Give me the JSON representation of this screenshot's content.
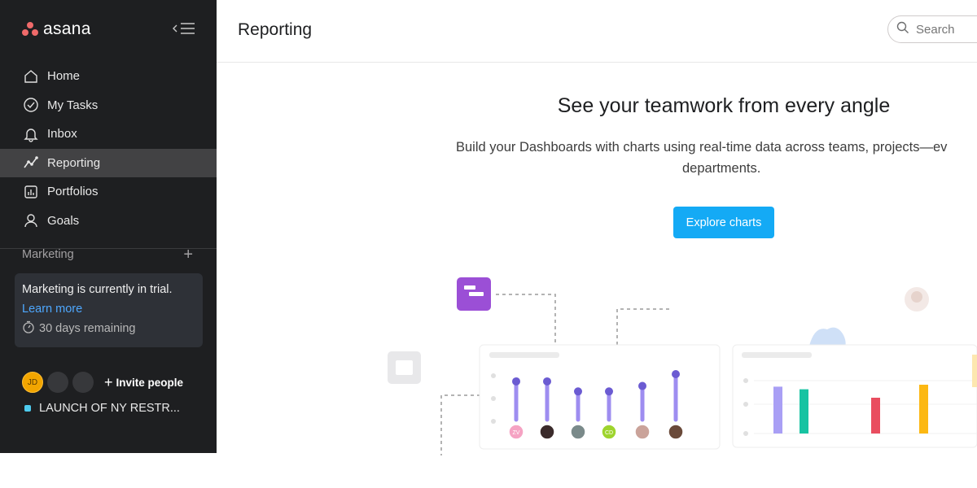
{
  "app": {
    "logo_text": "asana"
  },
  "sidebar": {
    "nav": [
      {
        "label": "Home",
        "icon": "home-icon"
      },
      {
        "label": "My Tasks",
        "icon": "check-circle-icon"
      },
      {
        "label": "Inbox",
        "icon": "bell-icon"
      },
      {
        "label": "Reporting",
        "icon": "trend-line-icon",
        "active": true
      },
      {
        "label": "Portfolios",
        "icon": "bar-chart-icon"
      },
      {
        "label": "Goals",
        "icon": "person-icon"
      }
    ],
    "team": {
      "name": "Marketing"
    },
    "trial": {
      "text": "Marketing is currently in trial.",
      "link": "Learn more",
      "remaining": "30 days remaining"
    },
    "people": {
      "avatar_initials": "JD",
      "invite_label": "Invite people"
    },
    "project": {
      "name": "LAUNCH OF NY RESTR...",
      "color": "#4ecbee"
    }
  },
  "header": {
    "title": "Reporting",
    "search_placeholder": "Search"
  },
  "hero": {
    "title": "See your teamwork from every angle",
    "subtitle_line1": "Build your Dashboards with charts using real-time data across teams, projects—ev",
    "subtitle_line2": "departments.",
    "cta": "Explore charts"
  },
  "colors": {
    "sidebar_bg": "#1e1f21",
    "active_item_bg": "#424244",
    "accent": "#14aaf5",
    "logo": "#f06a6a",
    "lollipop": "#9e8df0",
    "bars": [
      "#a99ff5",
      "#17c3a2",
      "#e94d5f",
      "#fcb813"
    ]
  },
  "illustration": {
    "lollipop_levels": [
      0.84,
      0.84,
      0.62,
      0.62,
      0.74,
      1.0
    ],
    "avatar_colors": [
      "#f5a3c3",
      "#3b2b2b",
      "#7a8a8a",
      "#9ed42e",
      "#caa39a",
      "#6a4a3a"
    ],
    "avatar_initial_texts": [
      "ZV",
      "",
      "",
      "CD",
      "",
      ""
    ],
    "bar_levels": [
      0.72,
      0.68,
      0.55,
      0.75
    ]
  }
}
